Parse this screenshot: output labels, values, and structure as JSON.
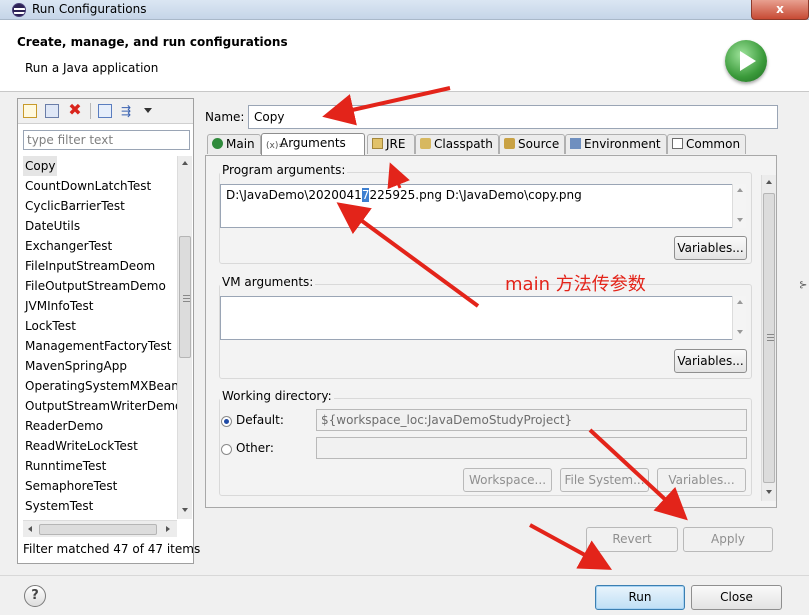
{
  "window": {
    "title": "Run Configurations",
    "close_label": "x"
  },
  "header": {
    "title": "Create, manage, and run configurations",
    "subtitle": "Run a Java application"
  },
  "left": {
    "filter_placeholder": "type filter text",
    "items": [
      "Copy",
      "CountDownLatchTest",
      "CyclicBarrierTest",
      "DateUtils",
      "ExchangerTest",
      "FileInputStreamDeom",
      "FileOutputStreamDemo",
      "JVMInfoTest",
      "LockTest",
      "ManagementFactoryTest",
      "MavenSpringApp",
      "OperatingSystemMXBeanTest",
      "OutputStreamWriterDemo",
      "ReaderDemo",
      "ReadWriteLockTest",
      "RunntimeTest",
      "SemaphoreTest",
      "SystemTest"
    ],
    "selected": "Copy",
    "status": "Filter matched 47 of 47 items"
  },
  "config": {
    "name_label": "Name:",
    "name_value": "Copy",
    "tabs": [
      "Main",
      "Arguments",
      "JRE",
      "Classpath",
      "Source",
      "Environment",
      "Common"
    ],
    "active_tab": "Arguments",
    "program_args_label": "Program arguments:",
    "program_args_before": "D:\\JavaDemo\\2020041",
    "program_args_selected": "7",
    "program_args_after": "225925.png D:\\JavaDemo\\copy.png",
    "variables_label": "Variables...",
    "vm_args_label": "VM arguments:",
    "vm_args_value": "",
    "working_dir_label": "Working directory:",
    "default_label": "Default:",
    "default_value": "${workspace_loc:JavaDemoStudyProject}",
    "other_label": "Other:",
    "other_value": "",
    "workspace_label": "Workspace...",
    "filesystem_label": "File System...",
    "revert_label": "Revert",
    "apply_label": "Apply"
  },
  "annotation": {
    "text": "main 方法传参数",
    "color": "#e3241a"
  },
  "footer": {
    "help_label": "?",
    "run_label": "Run",
    "close_label": "Close"
  },
  "icons": [
    "eclipse-icon",
    "run-icon",
    "new-config-icon",
    "duplicate-icon",
    "delete-icon",
    "collapse-icon",
    "filter-icon",
    "help-icon"
  ]
}
